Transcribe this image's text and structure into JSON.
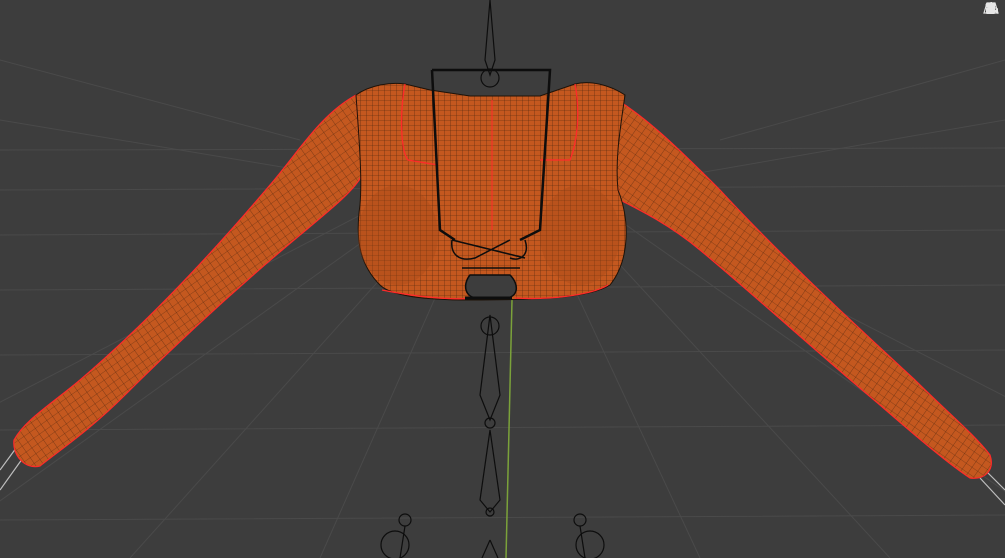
{
  "viewport": {
    "background": "#3d3d3d",
    "grid_color": "#4a4a4a",
    "axis_y_color": "#7ba23a"
  },
  "mesh": {
    "fill_color": "#c4581f",
    "wire_color": "#1e1208",
    "selection_outline_color": "#ff2a2a"
  },
  "armature": {
    "bone_color": "#0d0d0d",
    "bone_light_color": "#bdbdbd"
  },
  "toolbar": {
    "icons": [
      "hand-pan-icon",
      "camera-view-icon",
      "perspective-grid-icon"
    ]
  }
}
